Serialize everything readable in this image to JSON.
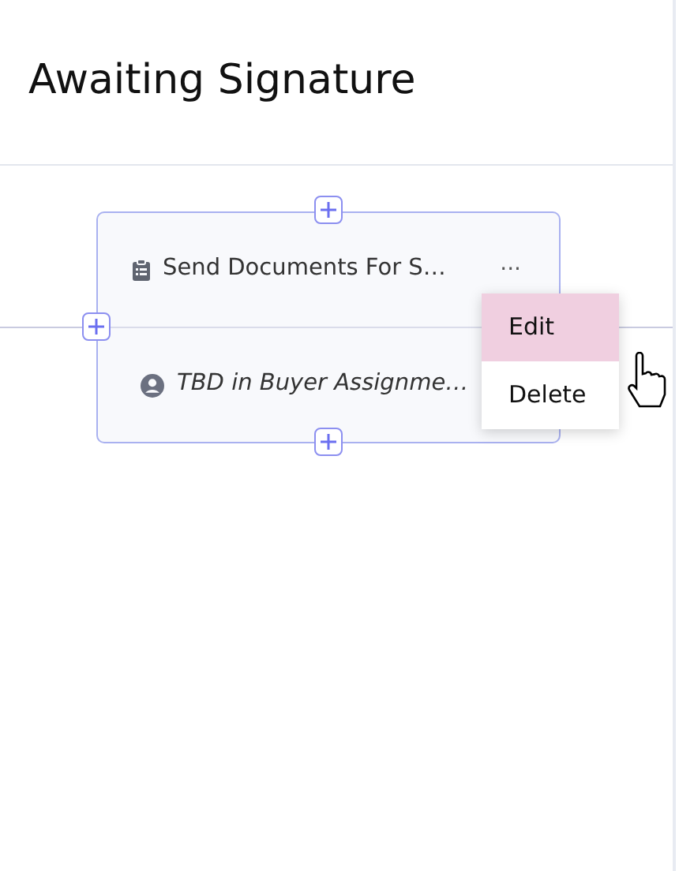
{
  "header": {
    "title": "Awaiting Signature"
  },
  "node": {
    "title": "Send Documents For S…",
    "assignee": "TBD in Buyer Assignme…",
    "more": "···"
  },
  "menu": {
    "open": true,
    "items": [
      {
        "label": "Edit",
        "selected": true
      },
      {
        "label": "Delete",
        "selected": false
      }
    ]
  }
}
